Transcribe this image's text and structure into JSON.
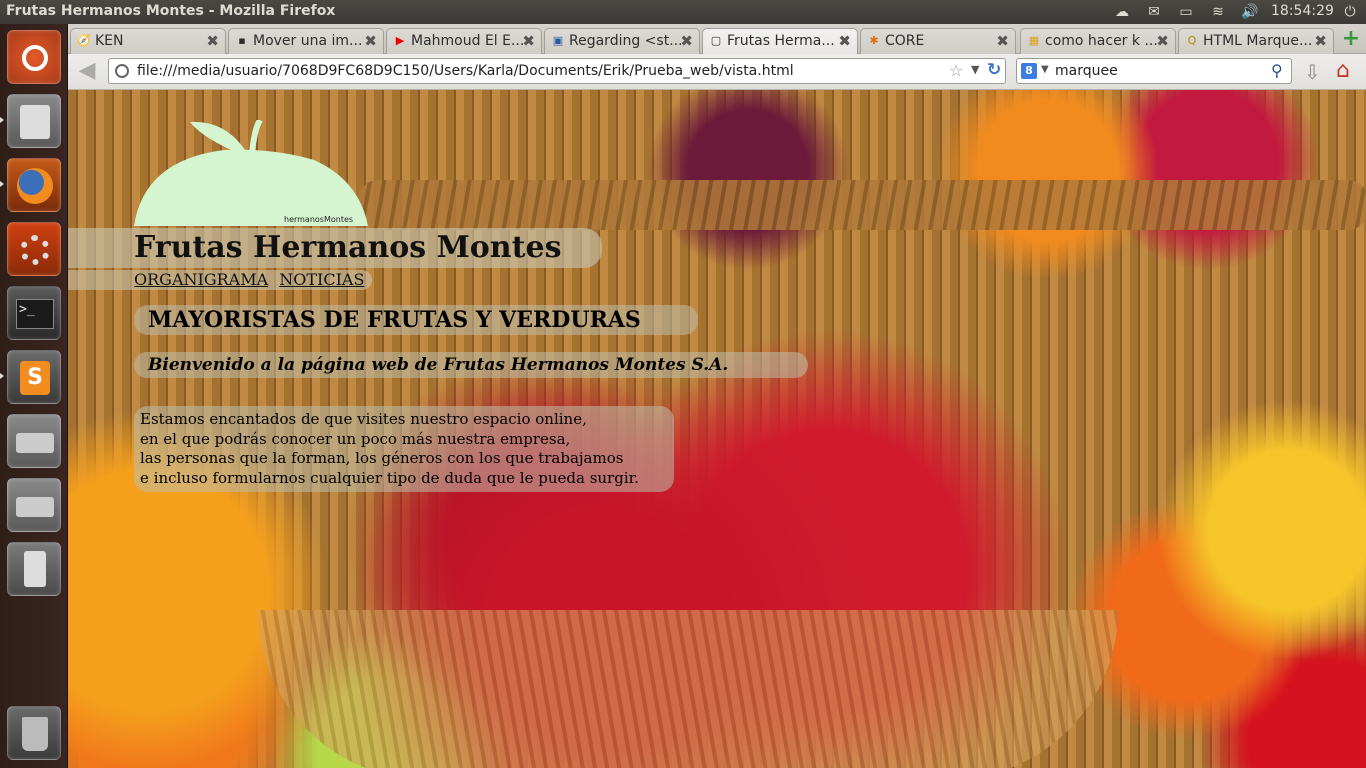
{
  "window": {
    "title": "Frutas Hermanos Montes - Mozilla Firefox"
  },
  "panel": {
    "clock": "18:54:29",
    "indicators": [
      "cloud-icon",
      "mail-icon",
      "battery-icon",
      "wifi-icon",
      "volume-icon",
      "power-icon"
    ]
  },
  "launcher": {
    "items": [
      "ubuntu-logo-icon",
      "file-cabinet-icon",
      "firefox-icon",
      "settings-icon",
      "terminal-icon",
      "sublime-text-icon",
      "hard-drive-icon",
      "hard-drive-icon",
      "media-player-icon",
      "trash-icon"
    ]
  },
  "tabs": [
    {
      "label": "KEN",
      "icon": "🧭"
    },
    {
      "label": "Mover una im...",
      "icon": "▪"
    },
    {
      "label": "Mahmoud El E...",
      "icon": "▶"
    },
    {
      "label": "Regarding <st...",
      "icon": "▣"
    },
    {
      "label": "Frutas Herma...",
      "icon": "▢"
    },
    {
      "label": "CORE",
      "icon": "✱"
    },
    {
      "label": "como hacer k ...",
      "icon": "▦"
    },
    {
      "label": "HTML Marque...",
      "icon": "Q"
    }
  ],
  "nav": {
    "url": "file:///media/usuario/7068D9FC68D9C150/Users/Karla/Documents/Erik/Prueba_web/vista.html",
    "search_engine": "8",
    "search_query": "marquee"
  },
  "page": {
    "logo_text": "hermanosMontes",
    "title": "Frutas Hermanos Montes",
    "menu": [
      "ORGANIGRAMA",
      "NOTICIAS"
    ],
    "tagline": "MAYORISTAS DE FRUTAS Y VERDURAS",
    "welcome": "Bienvenido a la página web de Frutas Hermanos Montes S.A.",
    "intro": [
      "Estamos encantados de que visites nuestro espacio online,",
      "en el que podrás conocer un poco más nuestra empresa,",
      "las personas que la forman, los géneros con los que trabajamos",
      "e incluso formularnos cualquier tipo de duda que le pueda surgir."
    ]
  },
  "colors": {
    "accent": "#f07746",
    "launcher_bg": "#3a2520",
    "logo_green": "#d4f5cf"
  }
}
